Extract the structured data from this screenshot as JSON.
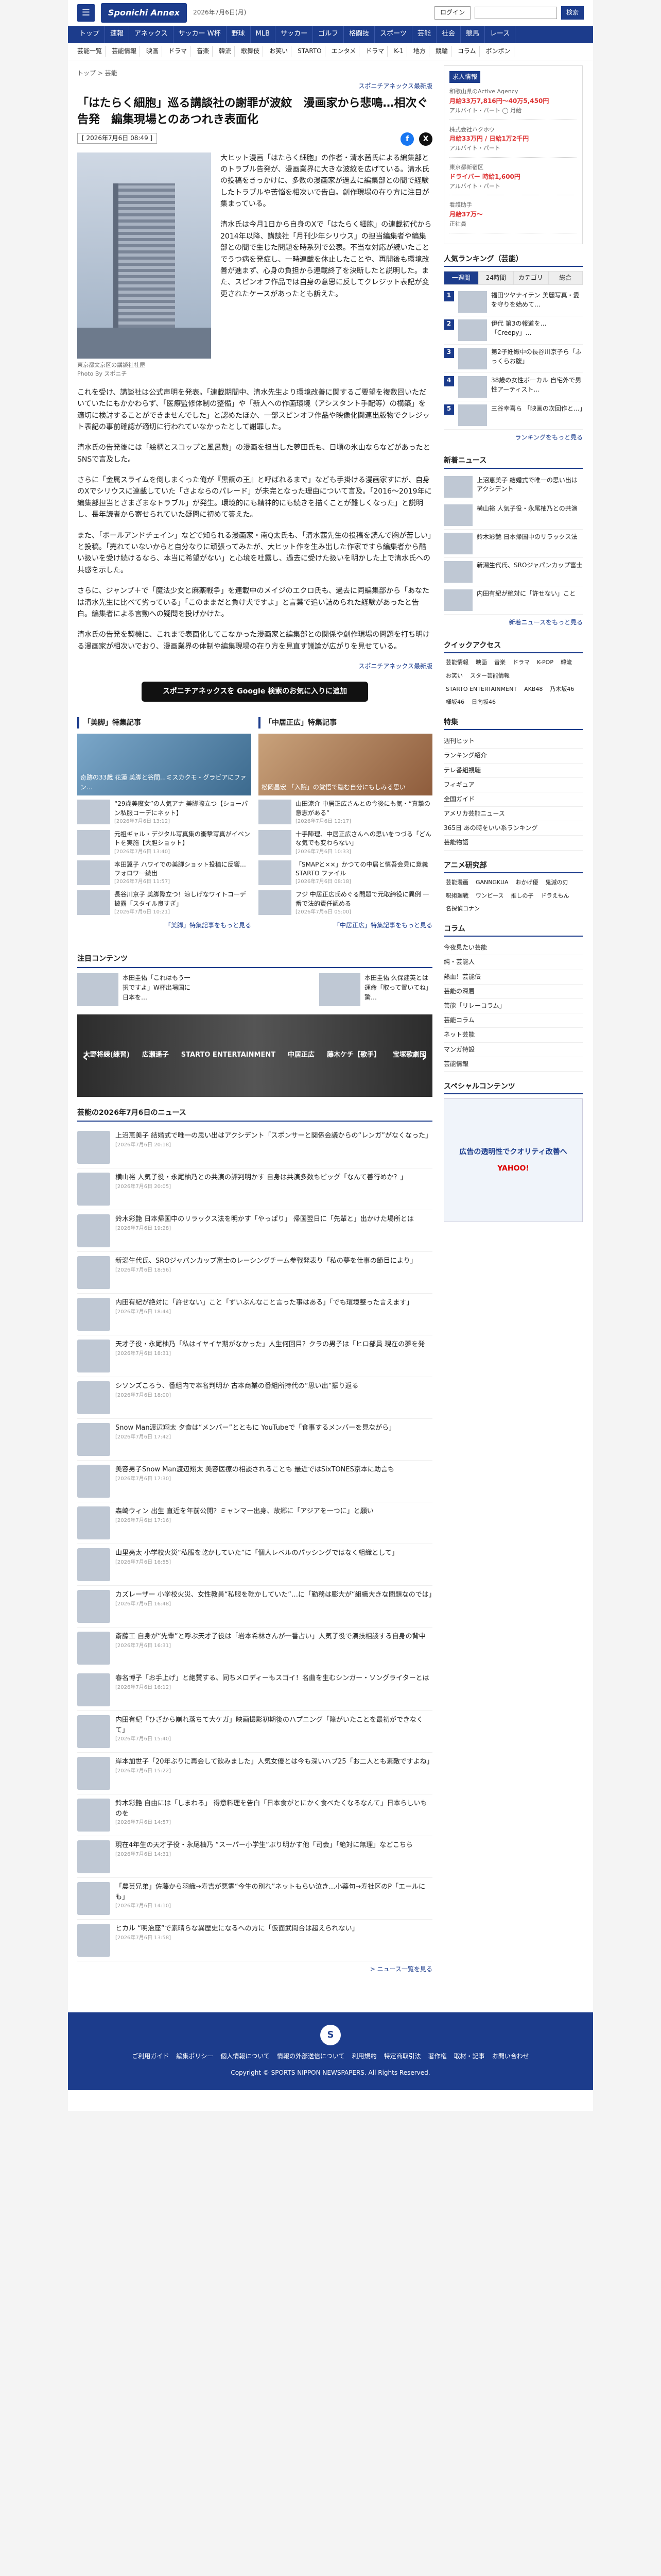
{
  "header": {
    "logo": "Sponichi Annex",
    "date": "2026年7月6日(月)",
    "login": "ログイン",
    "search_placeholder": "",
    "search_btn": "検索"
  },
  "nav": [
    "トップ",
    "速報",
    "アネックス",
    "サッカー W杯",
    "野球",
    "MLB",
    "サッカー",
    "ゴルフ",
    "格闘技",
    "スポーツ",
    "芸能",
    "社会",
    "競馬",
    "レース"
  ],
  "subnav": [
    "芸能一覧",
    "芸能情報",
    "映画",
    "ドラマ",
    "音楽",
    "韓流",
    "歌舞伎",
    "お笑い",
    "STARTO",
    "エンタメ",
    "ドラマ",
    "K-1",
    "地方",
    "競輪",
    "コラム",
    "ボンボン"
  ],
  "crumb": "トップ > 芸能",
  "source_top": "スポニチアネックス最新版",
  "title": "「はたらく細胞」巡る講談社の謝罪が波紋　漫画家から悲鳴…相次ぐ告発　編集現場とのあつれき表面化",
  "article_date": "[ 2026年7月6日 08:49 ]",
  "photo_caption": "東京都文京区の講談社社屋\nPhoto By スポニチ",
  "paras": [
    "大ヒット漫画「はたらく細胞」の作者・清水茜氏による編集部とのトラブル告発が、漫画業界に大きな波紋を広げている。清水氏の投稿をきっかけに、多数の漫画家が過去に編集部との間で経験したトラブルや苦悩を相次いで告白。創作現場の在り方に注目が集まっている。",
    "清水氏は今月1日から自身のXで「はたらく細胞」の連載初代から2014年以降、講談社「月刊少年シリウス」の担当編集者や編集部との間で生じた問題を時系列で公表。不当な対応が続いたことでうつ病を発症し、一時連載を休止したことや、再開後も環境改善が進まず、心身の負担から連載終了を決断したと説明した。また、スピンオフ作品では自身の意思に反してクレジット表記が変更されたケースがあったとも訴えた。",
    "これを受け、講談社は公式声明を発表。「連載期間中、清水先生より環境改善に関するご要望を複数回いただいていたにもかかわらず、「医療監修体制の整備」や「新人への作画環境（アシスタント手配等）の構築」を適切に検討することができませんでした」と認めたほか、一部スピンオフ作品や映像化関連出版物でクレジット表記の事前確認が適切に行われていなかったとして謝罪した。",
    "清水氏の告発後には「絵柄とスコップと風呂敷」の漫画を担当した夢田氏も、日頃の氷山ならなどがあったとSNSで言及した。",
    "さらに「金属スライムを倒しまくった俺が『黒鋼の王』と呼ばれるまで」なども手掛ける漫画家すにが、自身のXでシリウスに連載していた「さよならのパレード」が未完となった理由について言及。「2016〜2019年に編集部担当とさまざまなトラブル」が発生。環境的にも精神的にも続きを描くことが難しくなった」と説明し、長年読者から寄せられていた疑問に初めて答えた。",
    "また、「ボールアンドチェイン」などで知られる漫画家・南Q太氏も、「清水茜先生の投稿を読んで胸が苦しい」と投稿。「売れていないからと自分なりに頑張ってみたが、大ヒット作を生み出した作家ですら編集者から酷い扱いを受け続けるなら、本当に希望がない」と心境を吐露し、過去に受けた扱いを明かした上で清水氏への共感を示した。",
    "さらに、ジャンプ＋で「魔法少女と麻薬戦争」を連載中のメイジのエクロ氏も、過去に同編集部から「あなたは清水先生に比べて劣っている」「このままだと負け犬ですよ」と言葉で追い詰められた経験があったと告白。編集者による言動への疑問を投げかけた。",
    "清水氏の告発を契機に、これまで表面化してこなかった漫画家と編集部との関係や創作現場の問題を打ち明ける漫画家が相次いでおり、漫画業界の体制や編集現場の在り方を見直す議論が広がりを見せている。"
  ],
  "signature": "スポニチアネックス最新版",
  "google_btn": "スポニチアネックスを Google 検索のお気に入りに追加",
  "feat_left": {
    "title": "「美脚」特集記事",
    "img_caption": "奇跡の33歳 花蓮 美脚と谷間...ミスカクモ・グラビアにファン…",
    "items": [
      {
        "t": "“29歳美魔女”の人気アナ 美脚際立つ【ショーパン私服コーデにネット】",
        "d": "[2026年7月6日 13:12]"
      },
      {
        "t": "元祖ギャル・デジタル写真集の衝撃写真がイベントを実施【大胆ショット】",
        "d": "[2026年7月6日 13:40]"
      },
      {
        "t": "本田翼子 ハワイでの美脚ショット投稿に反響…フォロワー続出",
        "d": "[2026年7月6日 11:57]"
      },
      {
        "t": "長谷川京子 美脚際立つ！涼しげなワイトコーデ披露「スタイル良すぎ」",
        "d": "[2026年7月6日 10:21]"
      }
    ],
    "more": "「美脚」特集記事をもっと見る"
  },
  "feat_right": {
    "title": "「中居正広」特集記事",
    "img_caption": "松岡昌宏 「入院」の覚悟で臨む自分にもしみる思い",
    "items": [
      {
        "t": "山田涼介 中居正広さんとの今後にも気・“真摯の意志がある”",
        "d": "[2026年7月6日 12:17]"
      },
      {
        "t": "十手陣理、中居正広さんへの思いをつづる「どんな気でも変わらない」",
        "d": "[2026年7月6日 10:33]"
      },
      {
        "t": "「SMAPと××」かつての中居と慎吾会見に意義 STARTO ファイル",
        "d": "[2026年7月6日 08:18]"
      },
      {
        "t": "フジ 中居正広氏めぐる問題で元取締役に異例 一番で法的責任認める",
        "d": "[2026年7月6日 05:00]"
      }
    ],
    "more": "「中居正広」特集記事をもっと見る"
  },
  "attn_title": "注目コンテンツ",
  "attn": [
    {
      "t": "本田圭佑「これはもう一択ですよ」W杯出場国に日本を…"
    },
    {
      "t": "本田圭佑 久保建英とは運命「取って置いてね」驚…"
    }
  ],
  "banner": [
    "大野将練(練習)",
    "広瀬遥子",
    "STARTO ENTERTAINMENT",
    "中居正広",
    "藤木ケチ【歌手】",
    "宝塚歌劇団"
  ],
  "news_title": "芸能の2026年7月6日のニュース",
  "news": [
    {
      "t": "上沼恵美子 結婚式で唯一の思い出はアクシデント「スポンサーと関係会議からの“レンガ”がなくなった」",
      "d": "[2026年7月6日 20:18]"
    },
    {
      "t": "横山裕 人気子役・永尾柚乃との共演の評判明かす 自身は共演多数もピッグ「なんて善行めか？」",
      "d": "[2026年7月6日 20:05]"
    },
    {
      "t": "鈴木彩艶 日本帰国中のリラックス法を明かす「やっぱり」 帰国翌日に「先輩と」出かけた場所とは",
      "d": "[2026年7月6日 19:28]"
    },
    {
      "t": "新潟生代氏、SROジャパンカップ富士のレーシングチーム参戦発表り「私の夢を仕事の節目により」",
      "d": "[2026年7月6日 18:56]"
    },
    {
      "t": "内田有紀が絶対に「許せない」こと「ずいぶんなこと言った事はある」「でも環境整った言えます」",
      "d": "[2026年7月6日 18:44]"
    },
    {
      "t": "天才子役・永尾柚乃「私はイヤイヤ期がなかった」人生何回目？クラの男子は「ヒロ部員 現在の夢を発",
      "d": "[2026年7月6日 18:31]"
    },
    {
      "t": "シソンズころう、番組内で本名判明か 古本商業の番組所持代の“思い出”振り返る",
      "d": "[2026年7月6日 18:00]"
    },
    {
      "t": "Snow Man渡辺翔太 夕食は“メンバー”とともに YouTubeで「食事するメンバーを見ながら」",
      "d": "[2026年7月6日 17:42]"
    },
    {
      "t": "美容男子Snow Man渡辺翔太 美容医療の相談されることも 最近ではSixTONES京本に助言も",
      "d": "[2026年7月6日 17:30]"
    },
    {
      "t": "森崎ウィン 出生 直近を年前公開？ミャンマー出身、故郷に「アジアを一つに」と願い",
      "d": "[2026年7月6日 17:16]"
    },
    {
      "t": "山里亮太 小学校火災“私服を乾かしていた”に「個人レベルのパッシングではなく組織として」",
      "d": "[2026年7月6日 16:55]"
    },
    {
      "t": "カズレーザー 小学校火災、女性教員“私服を乾かしていた”…に「勤務は膨大が“組織大きな問題なのでは」",
      "d": "[2026年7月6日 16:48]"
    },
    {
      "t": "斎藤工 自身が“先輩”と呼ぶ天才子役は「岩本希林さんが一番占い」人気子役で演技相談する自身の背中",
      "d": "[2026年7月6日 16:31]"
    },
    {
      "t": "春名博子「お手上げ」と絶賛する、同ちメロディーもスゴイ！名曲を生むシンガー・ソングライターとは",
      "d": "[2026年7月6日 16:12]"
    },
    {
      "t": "内田有紀「ひざから崩れ落ちて大ケガ」映画撮影初期後のハプニング「障がいたことを最初ができなくて」",
      "d": "[2026年7月6日 15:40]"
    },
    {
      "t": "岸本加世子「20年ぶりに再会して飲みました」人気女優とは今も深いハブ25「お二人とも素敵ですよね」",
      "d": "[2026年7月6日 15:22]"
    },
    {
      "t": "鈴木彩艶 自由には「しまわる」 得意料理を告白「日本食がとにかく食べたくなるなんて」日本らしいものを",
      "d": "[2026年7月6日 14:57]"
    },
    {
      "t": "現在4年生の天才子役・永尾柚乃 “スーパー小学生”ぶり明かす他「司会」「絶対に無理」などこちら",
      "d": "[2026年7月6日 14:31]"
    },
    {
      "t": "「農芸兄弟」佐藤から羽織→寿吉が悪霊“今生の別れ”ネットもらい泣き…小薬句→寿社区のP「エールにも」",
      "d": "[2026年7月6日 14:10]"
    },
    {
      "t": "ヒカル “明治座”で素晴らな異歴史になるへの方に「仮面武問合は超えられない」",
      "d": "[2026年7月6日 13:58]"
    }
  ],
  "news_more": "> ニュース一覧を見る",
  "side": {
    "job_title": "求人情報",
    "jobs": [
      {
        "c": "和歌山県のActive Agency",
        "t": "月給33万7,816円〜40万5,450円",
        "p": "アルバイト・パート ◯ 月給"
      },
      {
        "c": "株式会社ハクホウ",
        "t": "月給33万円 / 日給1万2千円",
        "p": "アルバイト・パート"
      },
      {
        "c": "東京都新宿区",
        "t": "ドライバー 時給1,600円",
        "p": "アルバイト・パート"
      },
      {
        "c": "看護助手",
        "t": "月給37万〜",
        "p": "正社員"
      }
    ],
    "rank_title": "人気ランキング（芸能）",
    "tabs": [
      "一週間",
      "24時間",
      "カテゴリ",
      "総合"
    ],
    "rank": [
      "福田ツヤナイテン 美麗写真・愛を守りを始めて…",
      "伊代 第3の報道を…「Creepy」…",
      "第2子妊娠中の長谷川京子ら「ふっくらお腹」",
      "38歳の女性ボーカル 自宅外で男性アーティスト…",
      "三谷幸喜ら 「映画の次回作と…」"
    ],
    "rank_more": "ランキングをもっと見る",
    "new_title": "新着ニュース",
    "new": [
      "上沼恵美子 結婚式で唯一の思い出はアクシデント",
      "横山裕 人気子役・永尾柚乃との共演",
      "鈴木彩艶 日本帰国中のリラックス法",
      "新潟生代氏、SROジャパンカップ富士",
      "内田有紀が絶対に「許せない」こと"
    ],
    "new_more": "新着ニュースをもっと見る",
    "quick_title": "クイックアクセス",
    "quick": [
      "芸能情報",
      "映画",
      "音楽",
      "ドラマ",
      "K-POP",
      "韓流",
      "お笑い",
      "スター芸能情報",
      "STARTO ENTERTAINMENT",
      "AKB48",
      "乃木坂46",
      "欅坂46",
      "日向坂46"
    ],
    "special_title": "特集",
    "specials": [
      "週刊ヒット",
      "ランキング紹介",
      "テレ番組視聴",
      "フィギュア",
      "全国ガイド",
      "アメリカ芸能ニュース",
      "365日 あの時をいい系ランキング",
      "芸能物語"
    ],
    "anime_title": "アニメ研究部",
    "anime": [
      "芸能漫画",
      "GANNGKUA",
      "おかげ優",
      "鬼滅の刃",
      "呪術廻戦",
      "ワンピース",
      "推しの子",
      "ドラえもん",
      "名探偵コナン"
    ],
    "column_title": "コラム",
    "columns": [
      "今夜見たい芸能",
      "純・芸能人",
      "熱血！芸能伝",
      "芸能の深層",
      "芸能「リレーコラム」",
      "芸能コラム",
      "ネット芸能",
      "マンガ特設",
      "芸能情報"
    ],
    "promo_title": "スペシャルコンテンツ",
    "promo_text": "広告の透明性でクオリティ改善へ",
    "promo_brand": "YAHOO!"
  },
  "footer": {
    "links": [
      "ご利用ガイド",
      "編集ポリシー",
      "個人情報について",
      "情報の外部送信について",
      "利用規約",
      "特定商取引法",
      "著作権",
      "取材・記事",
      "お問い合わせ"
    ],
    "copy": "Copyright © SPORTS NIPPON NEWSPAPERS. All Rights Reserved."
  }
}
